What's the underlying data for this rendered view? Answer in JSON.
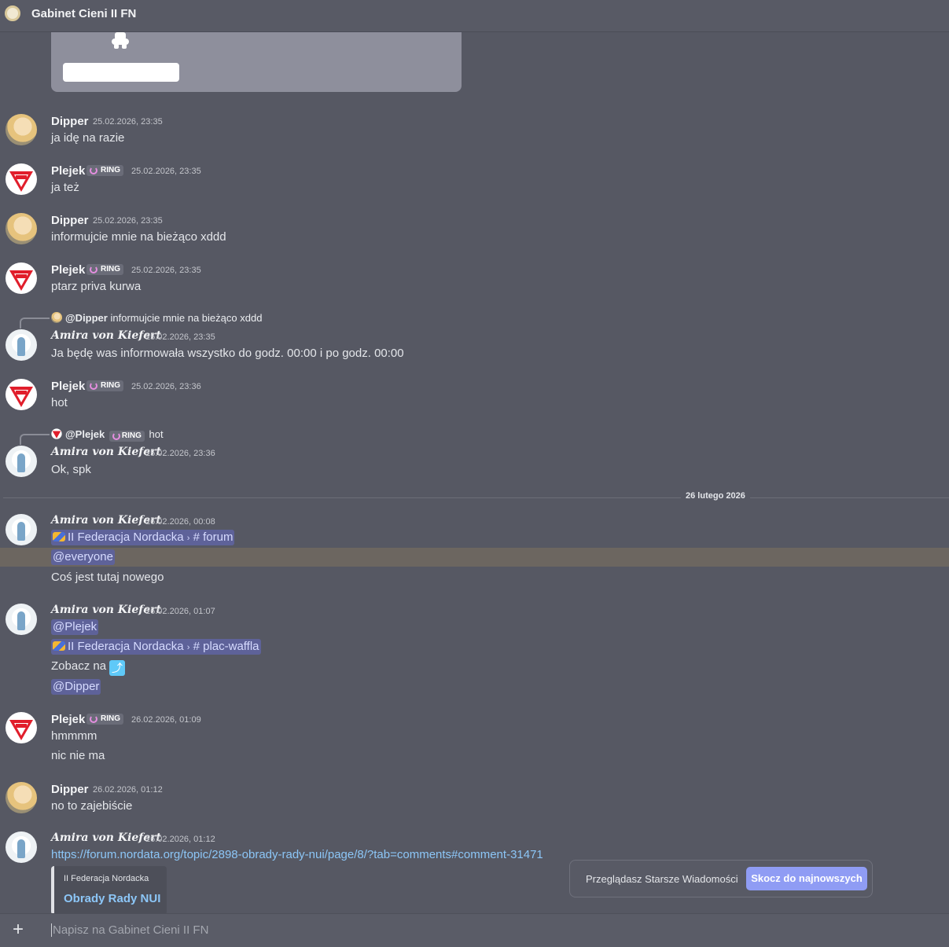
{
  "header": {
    "title": "Gabinet Cieni II FN"
  },
  "messages": [
    {
      "author": "Dipper",
      "timestamp": "25.02.2026, 23:35",
      "text": "ja idę na razie"
    },
    {
      "author": "Plejek",
      "tag": "RING",
      "timestamp": "25.02.2026, 23:35",
      "text": "ja też"
    },
    {
      "author": "Dipper",
      "timestamp": "25.02.2026, 23:35",
      "text": "informujcie mnie na bieżąco xddd"
    },
    {
      "author": "Plejek",
      "tag": "RING",
      "timestamp": "25.02.2026, 23:35",
      "text": "ptarz priva kurwa"
    },
    {
      "reply_to": "@Dipper",
      "reply_text": "informujcie mnie na bieżąco xddd",
      "author": "Amira von Kiefert",
      "timestamp": "25.02.2026, 23:35",
      "text": "Ja będę was informowała wszystko do godz. 00:00 i po godz. 00:00"
    },
    {
      "author": "Plejek",
      "tag": "RING",
      "timestamp": "25.02.2026, 23:36",
      "text": "hot"
    },
    {
      "reply_to": "@Plejek",
      "reply_tag": "RING",
      "reply_text": "hot",
      "author": "Amira von Kiefert",
      "timestamp": "25.02.2026, 23:36",
      "text": "Ok, spk"
    },
    {
      "author": "Amira von Kiefert",
      "timestamp": "26.02.2026, 00:08",
      "channel_server": "II Federacja Nordacka",
      "channel_sep": "›",
      "channel_name": "# forum",
      "mention": "@everyone",
      "text": "Coś jest tutaj nowego"
    },
    {
      "author": "Amira von Kiefert",
      "timestamp": "26.02.2026, 01:07",
      "mention": "@Plejek",
      "channel_server": "II Federacja Nordacka",
      "channel_sep": "›",
      "channel_name": "# plac-waffla",
      "text": "Zobacz na",
      "mention2": "@Dipper"
    },
    {
      "author": "Plejek",
      "tag": "RING",
      "timestamp": "26.02.2026, 01:09",
      "text": "hmmmm",
      "text2": "nic nie ma"
    },
    {
      "author": "Dipper",
      "timestamp": "26.02.2026, 01:12",
      "text": "no to zajebiście"
    },
    {
      "author": "Amira von Kiefert",
      "timestamp": "26.02.2026, 01:12",
      "link": "https://forum.nordata.org/topic/2898-obrady-rady-nui/page/8/?tab=comments#comment-31471",
      "embed_provider": "II Federacja Nordacka",
      "embed_title": "Obrady Rady NUI"
    }
  ],
  "date_divider": "26 lutego 2026",
  "jump_bar": {
    "label": "Przeglądasz Starsze Wiadomości",
    "button": "Skocz do najnowszych"
  },
  "composer": {
    "placeholder": "Napisz na Gabinet Cieni II FN"
  }
}
